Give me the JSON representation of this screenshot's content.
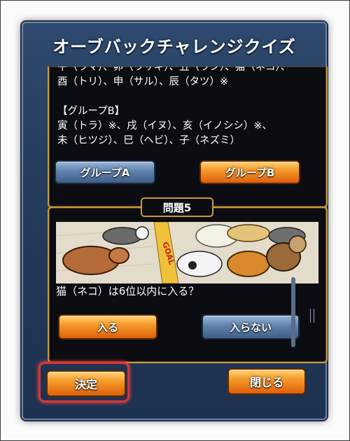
{
  "title": "オーブバックチャレンジクイズ",
  "rules": {
    "text": "午（ウマ）、卯（ウサギ）、丑（ウシ）、猫（ネコ）、\n酉（トリ）、申（サル）、辰（タツ）※\n\n【グループB】\n寅（トラ）※、戌（イヌ）、亥（イノシシ）※、\n未（ヒツジ）、巳（ヘビ）、子（ネズミ）",
    "group_a_label": "グループA",
    "group_b_label": "グループB"
  },
  "question": {
    "tab_label": "問題5",
    "goal_text": "GOAL",
    "text": "猫（ネコ）は6位以内に入る？",
    "enter_label": "入る",
    "not_enter_label": "入らない"
  },
  "footer": {
    "decide_label": "決定",
    "close_label": "閉じる"
  },
  "colors": {
    "panel": "#2a4266",
    "gold_border": "#c99a3a",
    "orange_button": "#f08a1c",
    "blue_button": "#5f82ad",
    "highlight_red": "#d93636"
  }
}
